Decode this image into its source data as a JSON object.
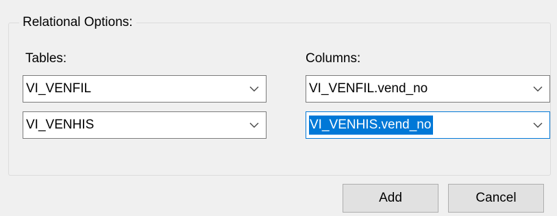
{
  "relational_options": {
    "title": "Relational Options:",
    "tables_label": "Tables:",
    "columns_label": "Columns:",
    "rows": [
      {
        "table": "VI_VENFIL",
        "column": "VI_VENFIL.vend_no"
      },
      {
        "table": "VI_VENHIS",
        "column": "VI_VENHIS.vend_no"
      }
    ]
  },
  "buttons": {
    "add_label": "Add",
    "cancel_label": "Cancel"
  },
  "icons": {
    "dropdown": "chevron-down-icon"
  },
  "colors": {
    "window_bg": "#f0f0f0",
    "selection": "#0078d7",
    "focus_border": "#0078d7",
    "button_bg": "#e1e1e1"
  }
}
